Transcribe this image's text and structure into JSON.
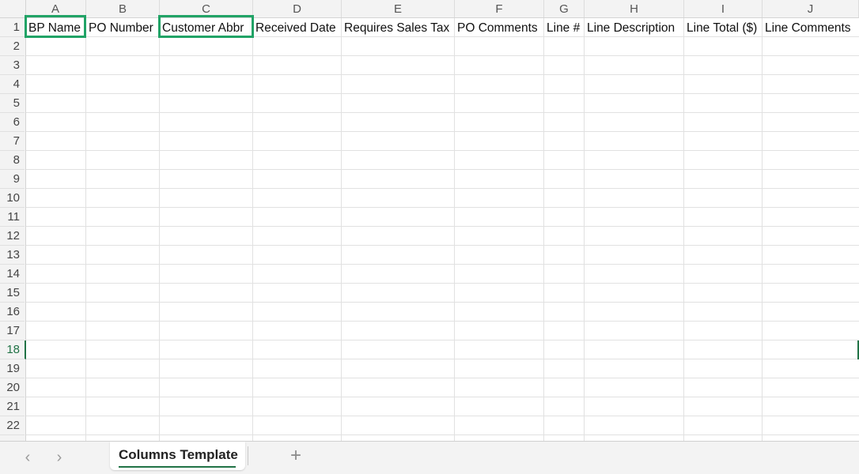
{
  "sheet": {
    "columns": [
      "A",
      "B",
      "C",
      "D",
      "E",
      "F",
      "G",
      "H",
      "I",
      "J"
    ],
    "rows": [
      "1",
      "2",
      "3",
      "4",
      "5",
      "6",
      "7",
      "8",
      "9",
      "10",
      "11",
      "12",
      "13",
      "14",
      "15",
      "16",
      "17",
      "18",
      "19",
      "20",
      "21",
      "22"
    ],
    "active_row": "18",
    "headers": [
      "BP Name",
      "PO Number",
      "Customer Abbr",
      "Received Date",
      "Requires Sales Tax",
      "PO Comments",
      "Line #",
      "Line Description",
      "Line Total ($)",
      "Line Comments"
    ],
    "highlighted_headers": [
      "BP Name",
      "Customer Abbr"
    ]
  },
  "tabs": {
    "prev_icon": "chevron-left-icon",
    "next_icon": "chevron-right-icon",
    "prev_glyph": "‹",
    "next_glyph": "›",
    "sheet_name": "Columns Template",
    "add_glyph": "+"
  },
  "colors": {
    "highlight": "#21a366",
    "accent": "#217346",
    "gridline": "#e1e1e1"
  }
}
